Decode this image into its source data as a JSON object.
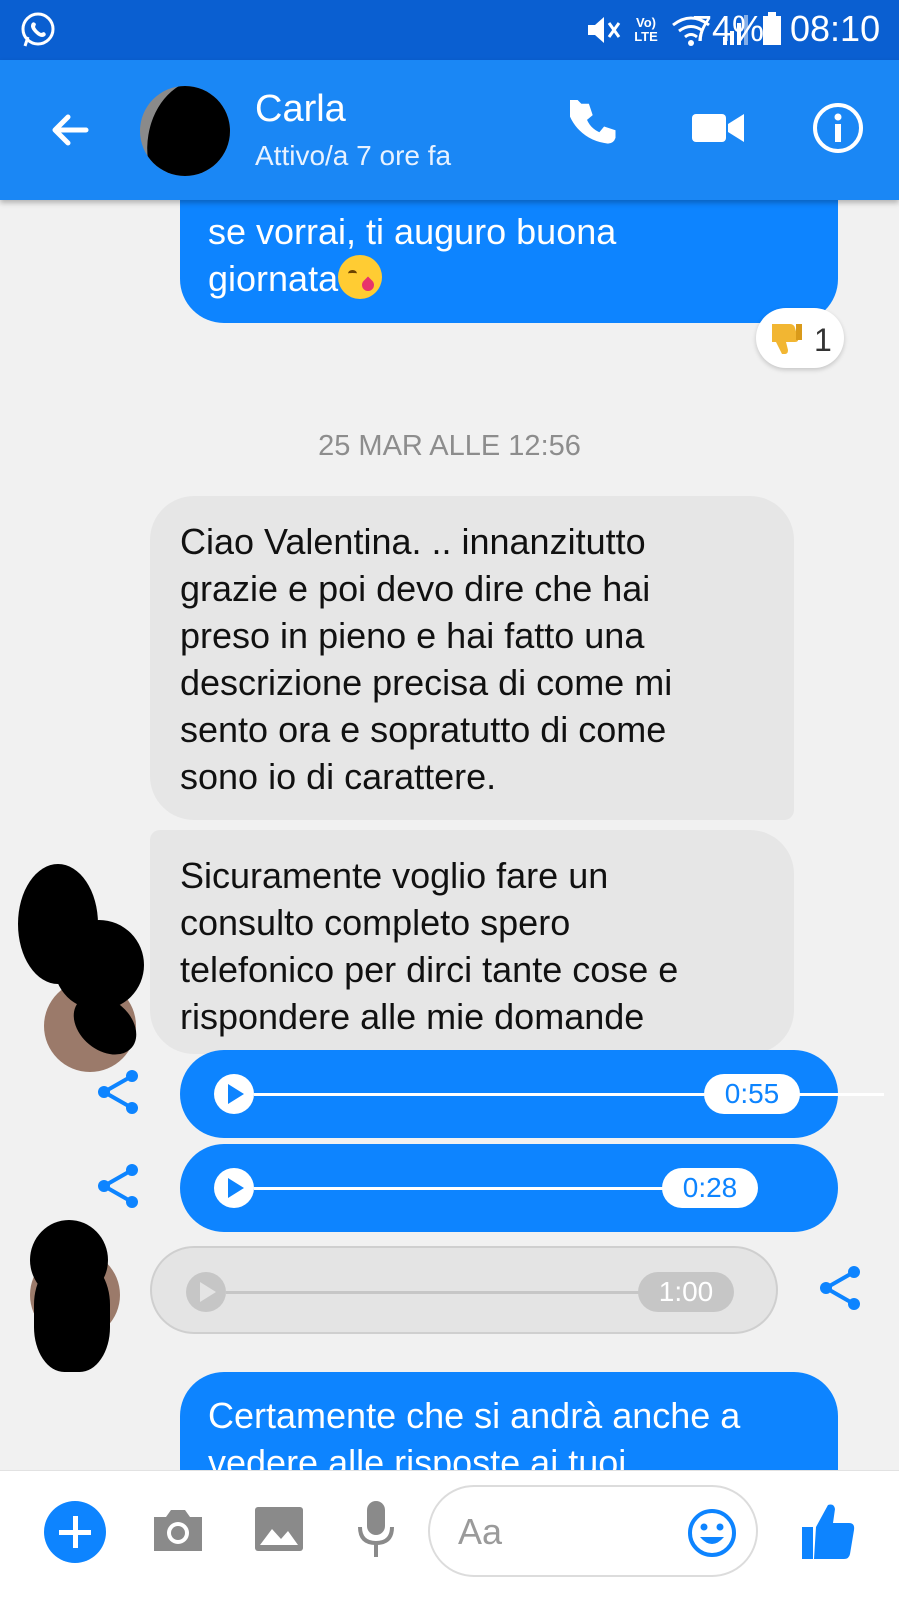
{
  "statusbar": {
    "battery": "74%",
    "time": "08:10",
    "network_label": "Vo) LTE",
    "icons": [
      "whatsapp-icon",
      "mute-icon",
      "volte-icon",
      "wifi-icon",
      "signal-icon",
      "battery-icon"
    ]
  },
  "header": {
    "contact_name": "Carla",
    "contact_status": "Attivo/a 7 ore fa",
    "icons": [
      "back-arrow-icon",
      "phone-icon",
      "video-camera-icon",
      "info-icon"
    ]
  },
  "messages": {
    "outgoing_1": {
      "lines": [
        "se vorrai, ti auguro buona",
        "giornata"
      ],
      "emoji": "face-blowing-kiss-emoji",
      "reaction": {
        "icon": "thumbs-down-icon",
        "count": "1"
      }
    },
    "date_separator": "25 MAR ALLE 12:56",
    "incoming_1": {
      "lines": [
        "Ciao Valentina. .. innanzitutto",
        "grazie e poi devo dire che hai",
        "preso in pieno e hai fatto una",
        "descrizione precisa di come mi",
        "sento ora e sopratutto di come",
        "sono io di carattere."
      ]
    },
    "incoming_2": {
      "lines": [
        "Sicuramente voglio fare un",
        "consulto completo spero",
        "telefonico per dirci tante cose e",
        "rispondere alle mie domande"
      ]
    },
    "voice_out_1": {
      "duration": "0:55"
    },
    "voice_out_2": {
      "duration": "0:28"
    },
    "voice_in_1": {
      "duration": "1:00"
    },
    "outgoing_2": {
      "lines": [
        "Certamente che si andrà anche a",
        "vedere alle risposte ai tuoi"
      ]
    }
  },
  "composer": {
    "placeholder": "Aa",
    "icons": [
      "plus-icon",
      "camera-icon",
      "gallery-icon",
      "microphone-icon",
      "emoji-icon",
      "thumbs-up-icon"
    ]
  },
  "colors": {
    "statusbar": "#0a5fd1",
    "header": "#1a87f5",
    "outgoing_bubble": "#0d84ff",
    "incoming_bubble": "#e6e6e6",
    "background": "#f1f1f1"
  }
}
